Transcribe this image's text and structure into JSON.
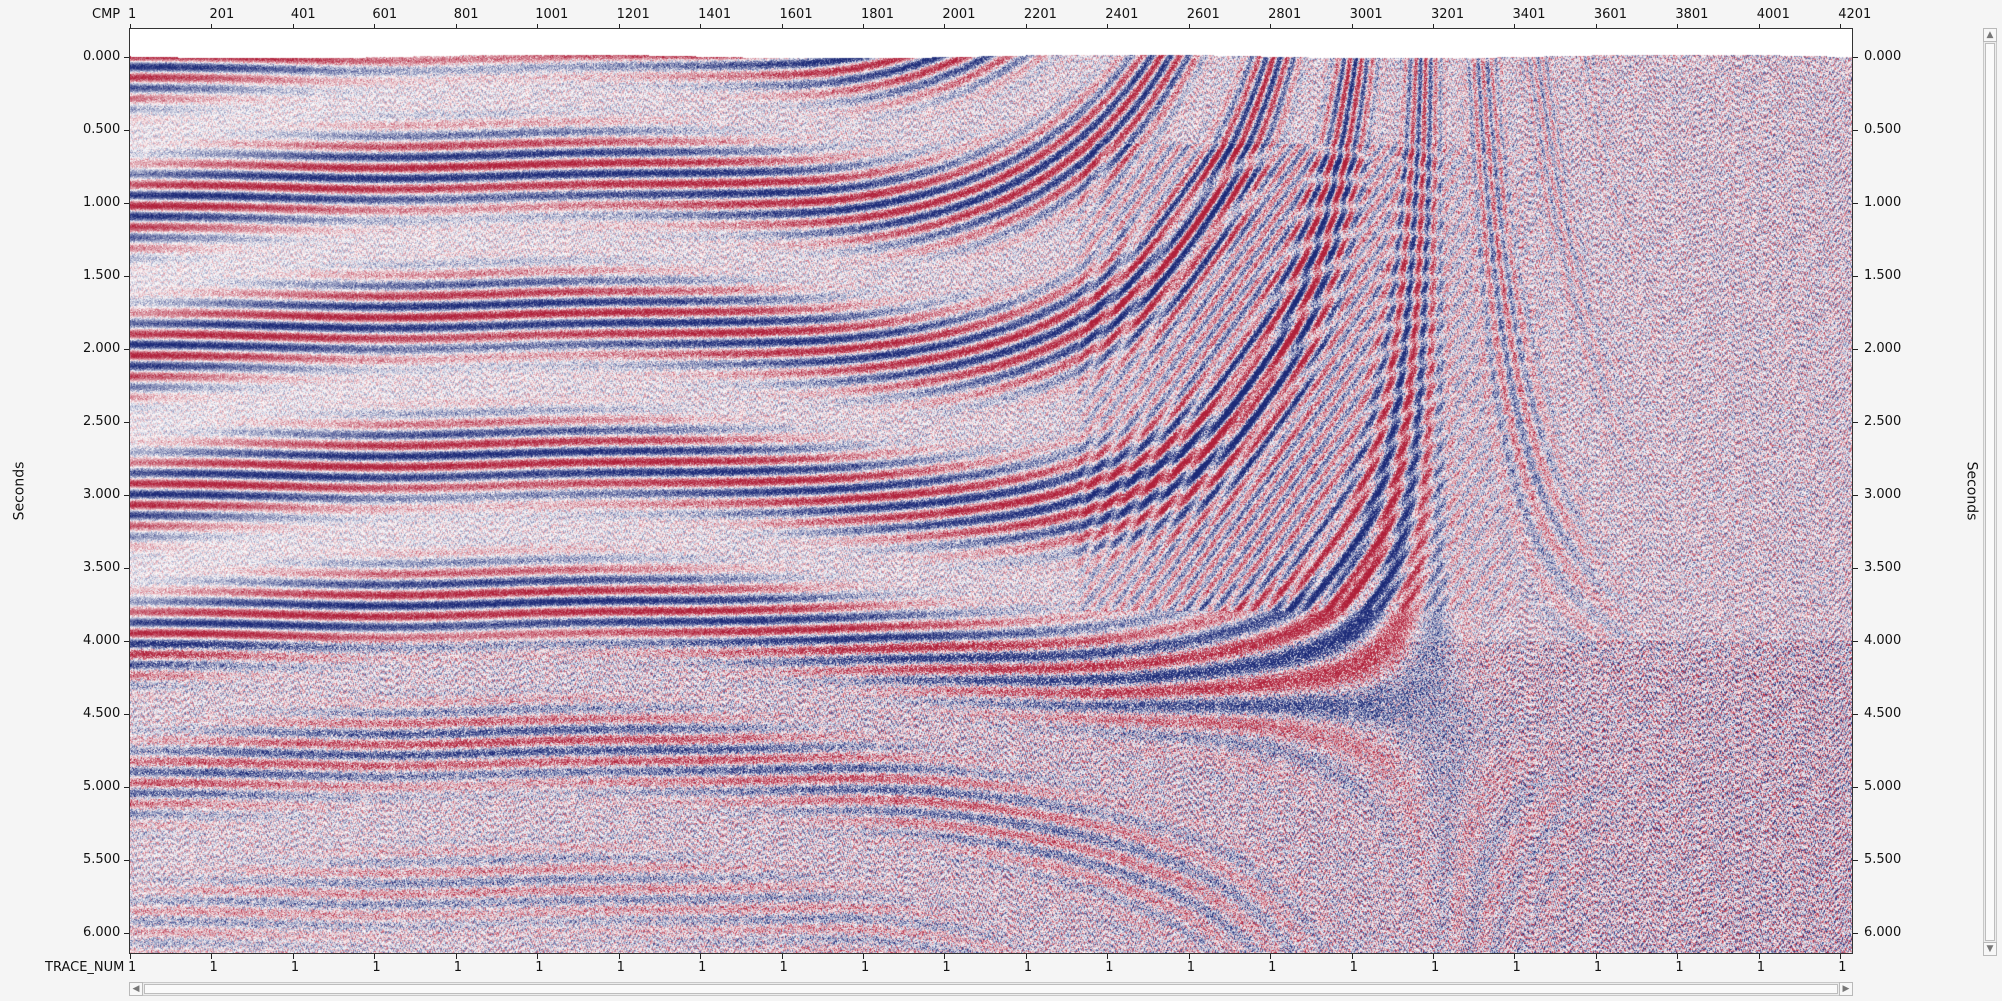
{
  "x_axis": {
    "name": "CMP",
    "ticks": [
      "1",
      "201",
      "401",
      "601",
      "801",
      "1001",
      "1201",
      "1401",
      "1601",
      "1801",
      "2001",
      "2201",
      "2401",
      "2601",
      "2801",
      "3001",
      "3201",
      "3401",
      "3601",
      "3801",
      "4001",
      "4201"
    ]
  },
  "bottom_axis": {
    "name": "TRACE_NUM",
    "ticks": [
      "1",
      "1",
      "1",
      "1",
      "1",
      "1",
      "1",
      "1",
      "1",
      "1",
      "1",
      "1",
      "1",
      "1",
      "1",
      "1",
      "1",
      "1",
      "1",
      "1",
      "1",
      "1"
    ]
  },
  "y_axis": {
    "name_left": "Seconds",
    "name_right": "Seconds",
    "ticks": [
      "0.000",
      "0.500",
      "1.000",
      "1.500",
      "2.000",
      "2.500",
      "3.000",
      "3.500",
      "4.000",
      "4.500",
      "5.000",
      "5.500",
      "6.000"
    ]
  },
  "display": {
    "max_time_s": 6.1,
    "cmp_first": 1,
    "cmp_last": 4230,
    "positive_color": "#b0203a",
    "negative_color": "#1c2a78",
    "background_color": "#ffffff"
  },
  "icons": {
    "scroll_up": "▲",
    "scroll_down": "▼",
    "scroll_left": "◀",
    "scroll_right": "▶"
  }
}
